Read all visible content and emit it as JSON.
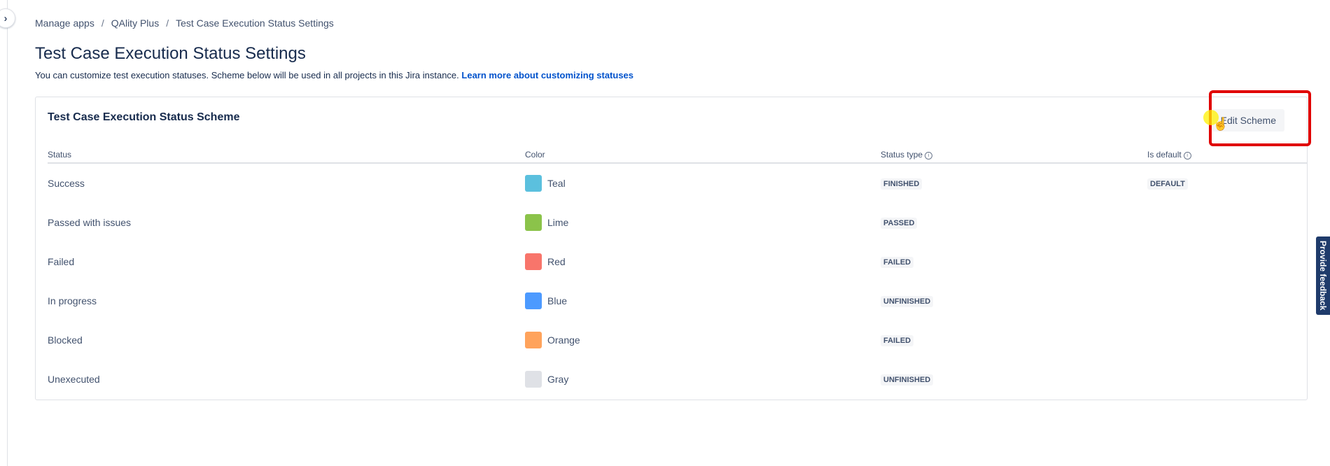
{
  "breadcrumb": [
    "Manage apps",
    "QAlity Plus",
    "Test Case Execution Status Settings"
  ],
  "page": {
    "title": "Test Case Execution Status Settings",
    "description": "You can customize test execution statuses. Scheme below will be used in all projects in this Jira instance.",
    "learn_more": "Learn more about customizing statuses"
  },
  "scheme": {
    "title": "Test Case Execution Status Scheme",
    "edit_label": "Edit Scheme",
    "columns": {
      "status": "Status",
      "color": "Color",
      "type": "Status type",
      "default": "Is default"
    },
    "rows": [
      {
        "status": "Success",
        "color": "Teal",
        "hex": "#5bc0de",
        "type": "FINISHED",
        "default": "DEFAULT"
      },
      {
        "status": "Passed with issues",
        "color": "Lime",
        "hex": "#8bc34a",
        "type": "PASSED",
        "default": ""
      },
      {
        "status": "Failed",
        "color": "Red",
        "hex": "#f8756b",
        "type": "FAILED",
        "default": ""
      },
      {
        "status": "In progress",
        "color": "Blue",
        "hex": "#4c9aff",
        "type": "UNFINISHED",
        "default": ""
      },
      {
        "status": "Blocked",
        "color": "Orange",
        "hex": "#ffa35c",
        "type": "FAILED",
        "default": ""
      },
      {
        "status": "Unexecuted",
        "color": "Gray",
        "hex": "#dfe1e6",
        "type": "UNFINISHED",
        "default": ""
      }
    ]
  },
  "feedback": {
    "label": "Provide feedback"
  },
  "icons": {
    "expand": "chevron-right-icon",
    "info": "info-icon"
  },
  "colors": {
    "link": "#0052cc",
    "highlight": "#e00000",
    "feedback_bg": "#1f3b6b"
  }
}
